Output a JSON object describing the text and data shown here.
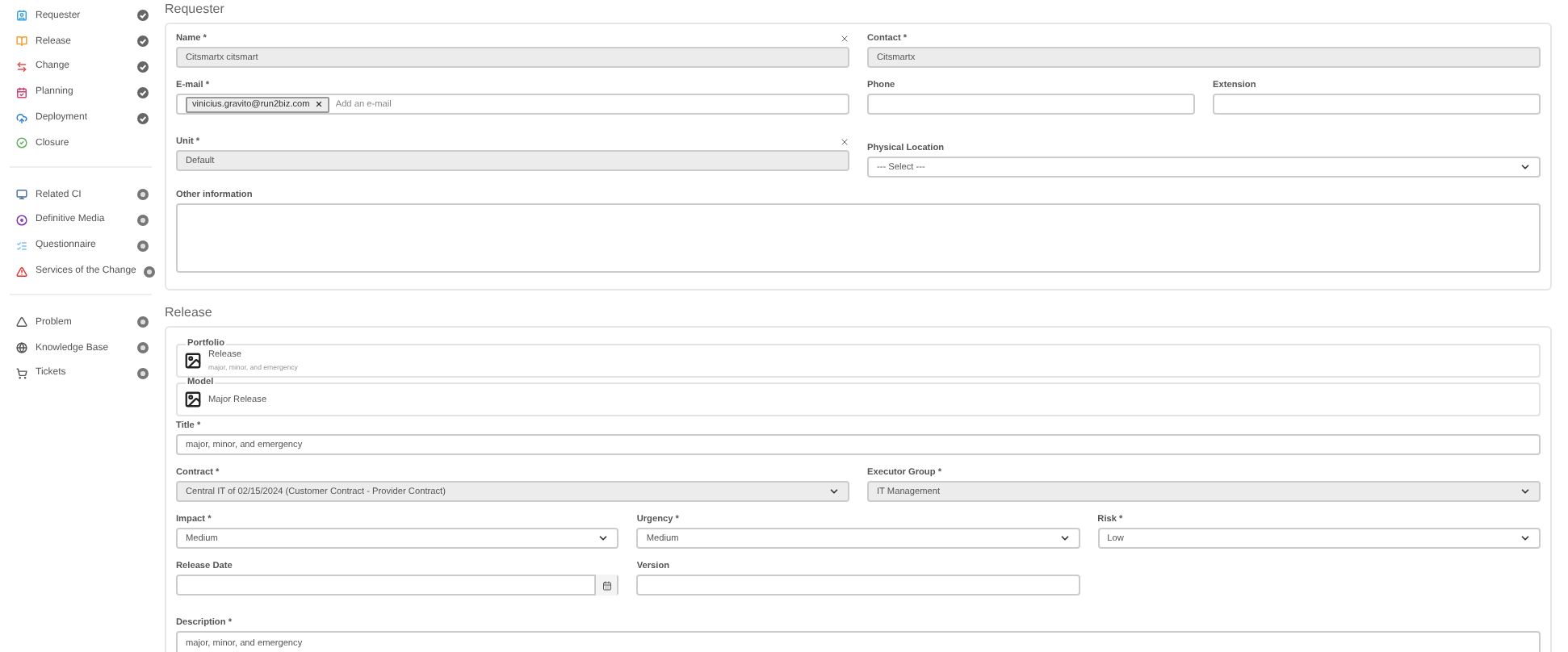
{
  "sidebar": {
    "groups": [
      {
        "items": [
          {
            "label": "Requester",
            "completed": true
          },
          {
            "label": "Release",
            "completed": true
          },
          {
            "label": "Change",
            "completed": true
          },
          {
            "label": "Planning",
            "completed": true
          },
          {
            "label": "Deployment",
            "completed": true
          },
          {
            "label": "Closure"
          }
        ]
      },
      {
        "items": [
          {
            "label": "Related CI",
            "completed": false
          },
          {
            "label": "Definitive Media",
            "completed": false
          },
          {
            "label": "Questionnaire",
            "completed": false
          },
          {
            "label": "Services of the Change",
            "completed": false
          }
        ]
      },
      {
        "items": [
          {
            "label": "Problem",
            "completed": false
          },
          {
            "label": "Knowledge Base",
            "completed": false
          },
          {
            "label": "Tickets",
            "completed": false
          }
        ]
      }
    ]
  },
  "requester": {
    "title": "Requester",
    "name": {
      "label": "Name *",
      "value": "Citsmartx citsmart"
    },
    "email": {
      "label": "E-mail *",
      "chips": [
        "vinicius.gravito@run2biz.com"
      ],
      "placeholder": "Add an e-mail"
    },
    "unit": {
      "label": "Unit *",
      "value": "Default"
    },
    "contact": {
      "label": "Contact *",
      "value": "Citsmartx"
    },
    "phone": {
      "label": "Phone"
    },
    "extension": {
      "label": "Extension"
    },
    "location": {
      "label": "Physical Location",
      "value": "--- Select ---"
    },
    "other": {
      "label": "Other information"
    }
  },
  "release": {
    "title": "Release",
    "portfolio": {
      "legend": "Portfolio",
      "title": "Release",
      "subtitle": "major, minor, and emergency"
    },
    "model": {
      "legend": "Model",
      "title": "Major Release"
    },
    "title_field": {
      "label": "Title *",
      "value": "major, minor, and emergency"
    },
    "contract": {
      "label": "Contract *",
      "value": "Central IT of 02/15/2024 (Customer Contract - Provider Contract)"
    },
    "executor": {
      "label": "Executor Group *",
      "value": "IT Management"
    },
    "impact": {
      "label": "Impact *",
      "value": "Medium"
    },
    "urgency": {
      "label": "Urgency *",
      "value": "Medium"
    },
    "risk": {
      "label": "Risk *",
      "value": "Low"
    },
    "release_date": {
      "label": "Release Date"
    },
    "version": {
      "label": "Version"
    },
    "description": {
      "label": "Description *",
      "value": "major, minor, and emergency"
    }
  }
}
